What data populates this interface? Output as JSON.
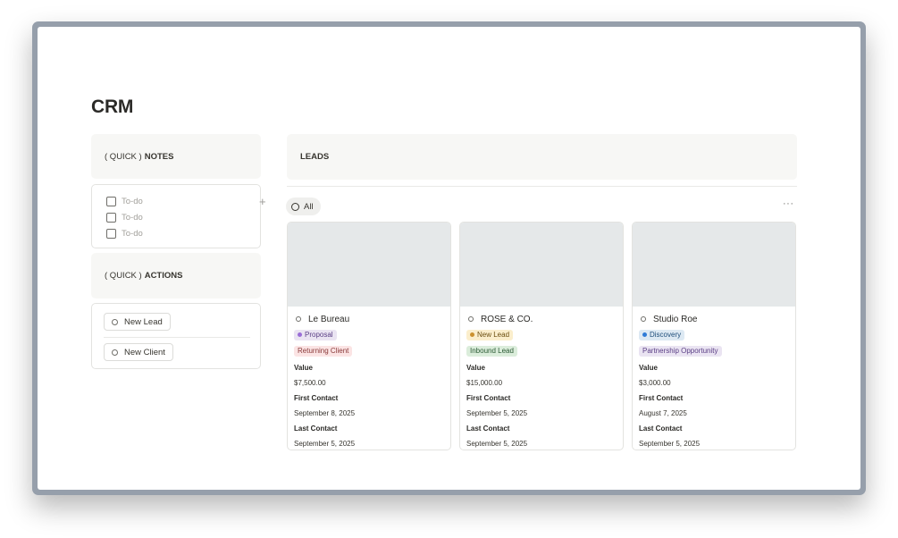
{
  "page": {
    "title": "CRM"
  },
  "notes": {
    "header_prefix": "( QUICK )",
    "header_bold": "NOTES",
    "todos": [
      {
        "placeholder": "To-do",
        "checked": false
      },
      {
        "placeholder": "To-do",
        "checked": false
      },
      {
        "placeholder": "To-do",
        "checked": false
      }
    ],
    "add_icon": "+"
  },
  "actions": {
    "header_prefix": "( QUICK )",
    "header_bold": "ACTIONS",
    "buttons": [
      {
        "label": "New Lead"
      },
      {
        "label": "New Client"
      }
    ]
  },
  "leads": {
    "header": "LEADS",
    "view_tab": "All",
    "more_icon": "···",
    "props": {
      "value_label": "Value",
      "first_contact_label": "First Contact",
      "last_contact_label": "Last Contact"
    },
    "cards": [
      {
        "name": "Le Bureau",
        "status": {
          "label": "Proposal",
          "bg": "#eae4f2",
          "dot": "#9a6dd7",
          "color": "#5a3e85"
        },
        "type": {
          "label": "Returning Client",
          "bg": "#fbe4e4",
          "color": "#8a3a3a"
        },
        "value": "$7,500.00",
        "first_contact": "September 8, 2025",
        "last_contact": "September 5, 2025"
      },
      {
        "name": "ROSE & CO.",
        "status": {
          "label": "New Lead",
          "bg": "#fbeecc",
          "dot": "#cb912f",
          "color": "#6b4e10"
        },
        "type": {
          "label": "Inbound Lead",
          "bg": "#dbeddb",
          "color": "#2b5a34"
        },
        "value": "$15,000.00",
        "first_contact": "September 5, 2025",
        "last_contact": "September 5, 2025"
      },
      {
        "name": "Studio Roe",
        "status": {
          "label": "Discovery",
          "bg": "#dde9f3",
          "dot": "#2f7bd6",
          "color": "#1f4e7a"
        },
        "type": {
          "label": "Partnership Opportunity",
          "bg": "#eae4f2",
          "color": "#5a3e85"
        },
        "value": "$3,000.00",
        "first_contact": "August 7, 2025",
        "last_contact": "September 5, 2025"
      }
    ]
  }
}
